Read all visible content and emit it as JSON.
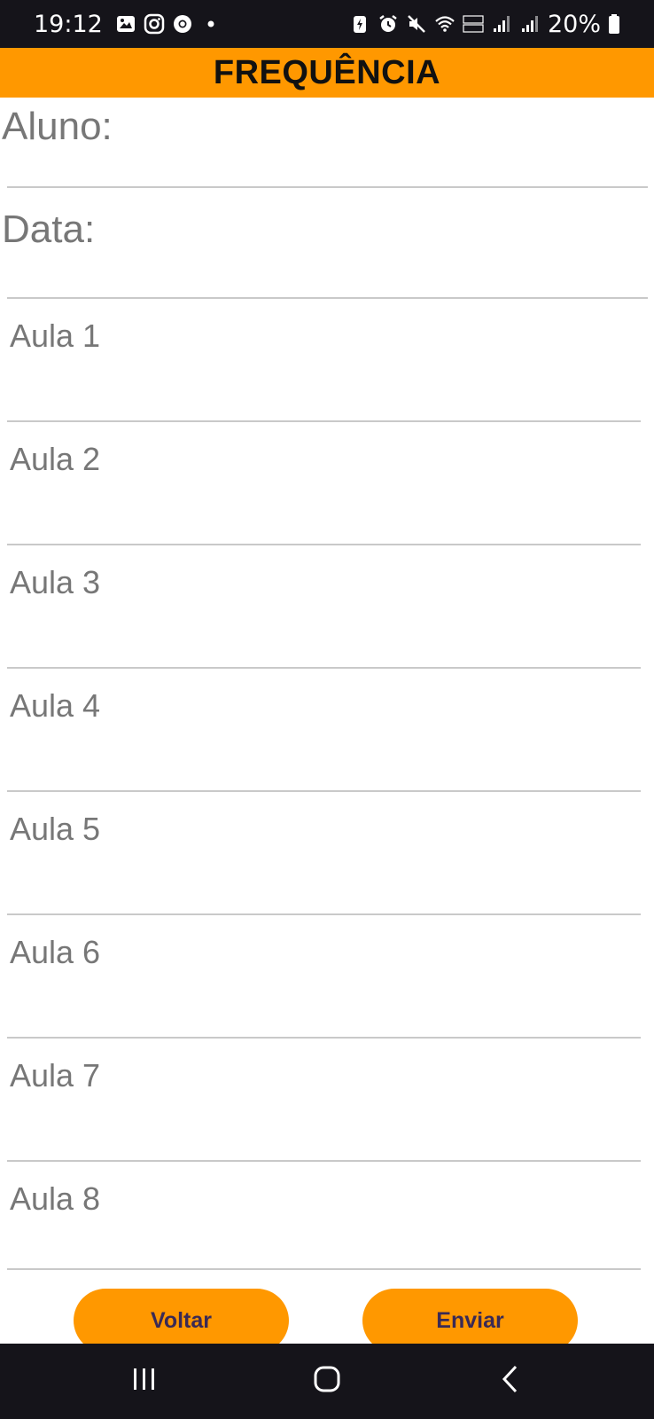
{
  "status_bar": {
    "time": "19:12",
    "battery_percent": "20%",
    "left_icons": [
      "gallery-icon",
      "instagram-icon",
      "chrome-icon",
      "dot-icon"
    ],
    "right_icons": [
      "battery-saver-icon",
      "alarm-icon",
      "mute-icon",
      "wifi-icon",
      "volte-icon",
      "signal-icon",
      "signal-icon-2",
      "battery-icon"
    ]
  },
  "header": {
    "title": "FREQUÊNCIA",
    "color": "#ff9800"
  },
  "form": {
    "aluno_label": "Aluno:",
    "data_label": "Data:",
    "aulas": [
      "Aula 1",
      "Aula 2",
      "Aula 3",
      "Aula 4",
      "Aula 5",
      "Aula 6",
      "Aula 7",
      "Aula 8"
    ]
  },
  "buttons": {
    "voltar": "Voltar",
    "enviar": "Enviar"
  },
  "nav_bar": {
    "icons": [
      "recent-apps-icon",
      "home-icon",
      "back-icon"
    ]
  }
}
